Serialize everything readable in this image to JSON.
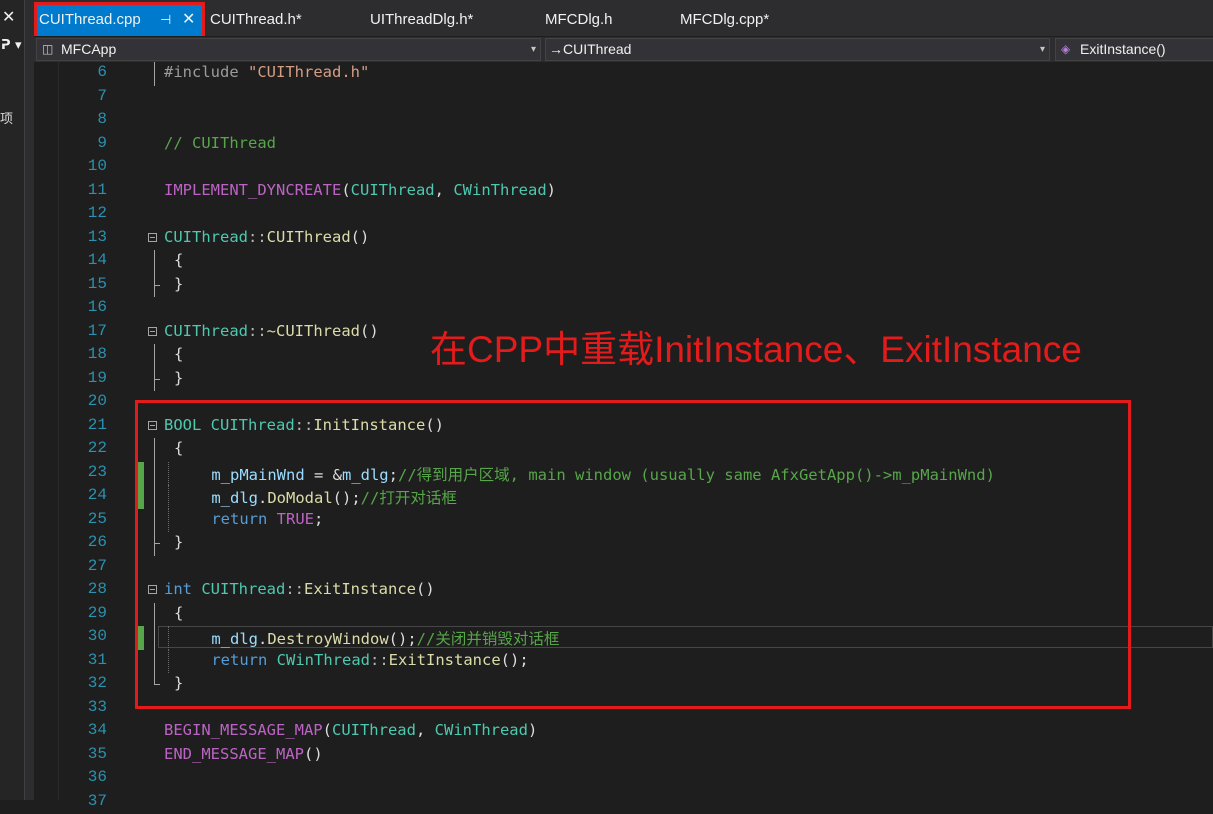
{
  "left_panel": {
    "close": "✕",
    "pin": "ᕈ ▾",
    "side_char": "项"
  },
  "tabs": [
    {
      "label": "CUIThread.cpp",
      "pin": "⊣",
      "close": "✕",
      "active": true
    },
    {
      "label": "CUIThread.h*"
    },
    {
      "label": "UIThreadDlg.h*"
    },
    {
      "label": "MFCDlg.h"
    },
    {
      "label": "MFCDlg.cpp*"
    }
  ],
  "nav": {
    "project": "MFCApp",
    "project_icon": "project-icon",
    "scope": "→CUIThread",
    "member": "ExitInstance()",
    "member_icon": "method-icon",
    "arrow": "▾"
  },
  "annotation": "在CPP中重载InitInstance、ExitInstance",
  "colors": {
    "accent": "#007acc",
    "highlight": "#e31b1b",
    "background": "#1e1e1e"
  },
  "lines": [
    {
      "n": "6",
      "tokens": [
        [
          "pp",
          "#include "
        ],
        [
          "s",
          "\"CUIThread.h\""
        ]
      ]
    },
    {
      "n": "7",
      "tokens": []
    },
    {
      "n": "8",
      "tokens": []
    },
    {
      "n": "9",
      "tokens": [
        [
          "c",
          "// CUIThread"
        ]
      ]
    },
    {
      "n": "10",
      "tokens": []
    },
    {
      "n": "11",
      "tokens": [
        [
          "m",
          "IMPLEMENT_DYNCREATE"
        ],
        [
          "d",
          "("
        ],
        [
          "t",
          "CUIThread"
        ],
        [
          "d",
          ", "
        ],
        [
          "t",
          "CWinThread"
        ],
        [
          "d",
          ")"
        ]
      ]
    },
    {
      "n": "12",
      "tokens": []
    },
    {
      "n": "13",
      "tokens": [
        [
          "t",
          "CUIThread"
        ],
        [
          "op",
          "::"
        ],
        [
          "f",
          "CUIThread"
        ],
        [
          "d",
          "()"
        ]
      ]
    },
    {
      "n": "14",
      "tokens": [
        [
          "d",
          "{"
        ]
      ]
    },
    {
      "n": "15",
      "tokens": [
        [
          "d",
          "}"
        ]
      ]
    },
    {
      "n": "16",
      "tokens": []
    },
    {
      "n": "17",
      "tokens": [
        [
          "t",
          "CUIThread"
        ],
        [
          "op",
          "::"
        ],
        [
          "f",
          "~CUIThread"
        ],
        [
          "d",
          "()"
        ]
      ]
    },
    {
      "n": "18",
      "tokens": [
        [
          "d",
          "{"
        ]
      ]
    },
    {
      "n": "19",
      "tokens": [
        [
          "d",
          "}"
        ]
      ]
    },
    {
      "n": "20",
      "tokens": []
    },
    {
      "n": "21",
      "tokens": [
        [
          "t",
          "BOOL"
        ],
        [
          "d",
          " "
        ],
        [
          "t",
          "CUIThread"
        ],
        [
          "op",
          "::"
        ],
        [
          "f",
          "InitInstance"
        ],
        [
          "d",
          "()"
        ]
      ]
    },
    {
      "n": "22",
      "tokens": [
        [
          "d",
          "{"
        ]
      ]
    },
    {
      "n": "23",
      "tokens": [
        [
          "d",
          "    "
        ],
        [
          "v",
          "m_pMainWnd"
        ],
        [
          "d",
          " = &"
        ],
        [
          "v",
          "m_dlg"
        ],
        [
          "d",
          ";"
        ],
        [
          "c",
          "//得到用户区域, main window (usually same AfxGetApp()->m_pMainWnd)"
        ]
      ]
    },
    {
      "n": "24",
      "tokens": [
        [
          "d",
          "    "
        ],
        [
          "v",
          "m_dlg"
        ],
        [
          "d",
          "."
        ],
        [
          "f",
          "DoModal"
        ],
        [
          "d",
          "();"
        ],
        [
          "c",
          "//打开对话框"
        ]
      ]
    },
    {
      "n": "25",
      "tokens": [
        [
          "d",
          "    "
        ],
        [
          "k",
          "return"
        ],
        [
          "d",
          " "
        ],
        [
          "m",
          "TRUE"
        ],
        [
          "d",
          ";"
        ]
      ]
    },
    {
      "n": "26",
      "tokens": [
        [
          "d",
          "}"
        ]
      ]
    },
    {
      "n": "27",
      "tokens": []
    },
    {
      "n": "28",
      "tokens": [
        [
          "k",
          "int"
        ],
        [
          "d",
          " "
        ],
        [
          "t",
          "CUIThread"
        ],
        [
          "op",
          "::"
        ],
        [
          "f",
          "ExitInstance"
        ],
        [
          "d",
          "()"
        ]
      ]
    },
    {
      "n": "29",
      "tokens": [
        [
          "d",
          "{"
        ]
      ]
    },
    {
      "n": "30",
      "tokens": [
        [
          "d",
          "    "
        ],
        [
          "v",
          "m_dlg"
        ],
        [
          "d",
          "."
        ],
        [
          "f",
          "DestroyWindow"
        ],
        [
          "d",
          "();"
        ],
        [
          "c",
          "//关闭并销毁对话框"
        ]
      ]
    },
    {
      "n": "31",
      "tokens": [
        [
          "d",
          "    "
        ],
        [
          "k",
          "return"
        ],
        [
          "d",
          " "
        ],
        [
          "t",
          "CWinThread"
        ],
        [
          "op",
          "::"
        ],
        [
          "f",
          "ExitInstance"
        ],
        [
          "d",
          "();"
        ]
      ]
    },
    {
      "n": "32",
      "tokens": [
        [
          "d",
          "}"
        ]
      ]
    },
    {
      "n": "33",
      "tokens": []
    },
    {
      "n": "34",
      "tokens": [
        [
          "m",
          "BEGIN_MESSAGE_MAP"
        ],
        [
          "d",
          "("
        ],
        [
          "t",
          "CUIThread"
        ],
        [
          "d",
          ", "
        ],
        [
          "t",
          "CWinThread"
        ],
        [
          "d",
          ")"
        ]
      ]
    },
    {
      "n": "35",
      "tokens": [
        [
          "m",
          "END_MESSAGE_MAP"
        ],
        [
          "d",
          "()"
        ]
      ]
    },
    {
      "n": "36",
      "tokens": []
    },
    {
      "n": "37",
      "tokens": []
    }
  ]
}
